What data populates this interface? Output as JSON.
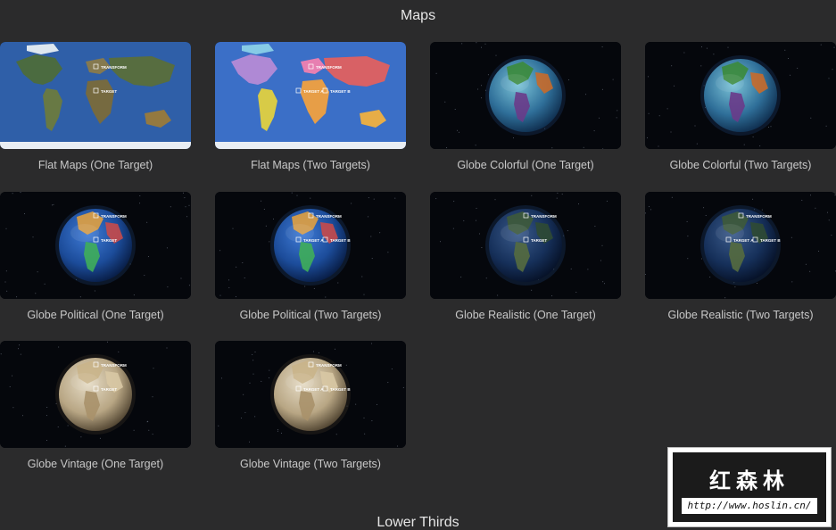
{
  "sections": {
    "maps": "Maps",
    "lower_thirds": "Lower Thirds"
  },
  "tiles": [
    {
      "label": "Flat Maps (One Target)",
      "kind": "flat-realistic",
      "targets": 1
    },
    {
      "label": "Flat Maps (Two Targets)",
      "kind": "flat-political",
      "targets": 2
    },
    {
      "label": "Globe Colorful (One Target)",
      "kind": "globe-colorful",
      "targets": 1
    },
    {
      "label": "Globe Colorful (Two Targets)",
      "kind": "globe-colorful",
      "targets": 2
    },
    {
      "label": "Globe Political (One Target)",
      "kind": "globe-political",
      "targets": 1
    },
    {
      "label": "Globe Political (Two Targets)",
      "kind": "globe-political",
      "targets": 2
    },
    {
      "label": "Globe Realistic (One Target)",
      "kind": "globe-realistic",
      "targets": 1
    },
    {
      "label": "Globe Realistic (Two Targets)",
      "kind": "globe-realistic",
      "targets": 2
    },
    {
      "label": "Globe Vintage (One Target)",
      "kind": "globe-vintage",
      "targets": 1
    },
    {
      "label": "Globe Vintage (Two Targets)",
      "kind": "globe-vintage",
      "targets": 2
    }
  ],
  "thumb_labels": {
    "transform": "TRANSFORM",
    "target": "TARGET",
    "target_a": "TARGET A",
    "target_b": "TARGET B"
  },
  "watermark": {
    "title": "红森林",
    "url": "http://www.hoslin.cn/"
  },
  "colors": {
    "background": "#2b2b2c",
    "ocean": "#2f5fa8",
    "political_ocean": "#3b6fc7",
    "space": "#05070c"
  }
}
